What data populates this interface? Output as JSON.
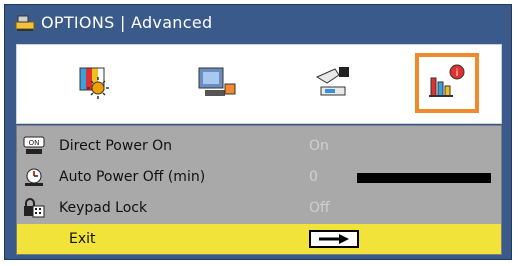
{
  "window": {
    "title": "OPTIONS | Advanced",
    "title_icon": "options-icon"
  },
  "tabs": [
    {
      "name": "image-settings-tab",
      "icon": "image-sun-icon",
      "active": false
    },
    {
      "name": "display-settings-tab",
      "icon": "display-projector-icon",
      "active": false
    },
    {
      "name": "setup-tab",
      "icon": "hand-setup-icon",
      "active": false
    },
    {
      "name": "options-tab",
      "icon": "options-info-icon",
      "active": true
    }
  ],
  "menu": {
    "items": [
      {
        "label": "Direct Power On",
        "value": "On",
        "icon": "power-on-icon"
      },
      {
        "label": "Auto Power Off (min)",
        "value": "0",
        "icon": "timer-icon",
        "slider_level": 0
      },
      {
        "label": "Keypad Lock",
        "value": "Off",
        "icon": "keypad-lock-icon"
      },
      {
        "label": "Exit",
        "value": "",
        "icon": "arrow-right-icon"
      }
    ]
  },
  "colors": {
    "frame": "#3a5a8c",
    "panel": "#a9a9a9",
    "highlight": "#f2e33a",
    "active_tab_border": "#f08a2c"
  }
}
